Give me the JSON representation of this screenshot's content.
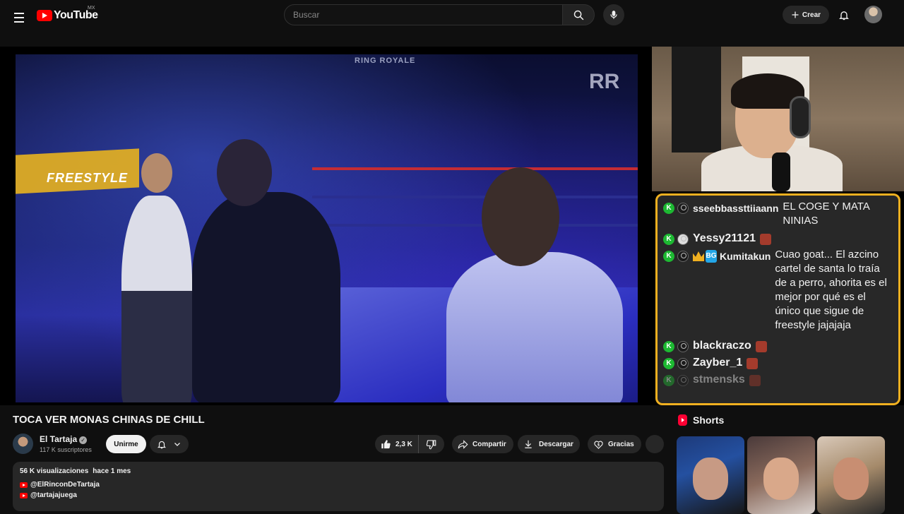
{
  "header": {
    "logo_text": "YouTube",
    "country_code": "MX",
    "search_placeholder": "Buscar",
    "create_label": "Crear"
  },
  "video": {
    "overlay_brand": "RING ROYALE",
    "banner_text": "FREESTYLE",
    "title": "TOCA VER MONAS CHINAS DE CHILL"
  },
  "channel": {
    "name": "El Tartaja",
    "subscribers": "117 K suscriptores",
    "join_label": "Unirme"
  },
  "actions": {
    "likes": "2,3 K",
    "share_label": "Compartir",
    "download_label": "Descargar",
    "thanks_label": "Gracias"
  },
  "description": {
    "views": "56 K visualizaciones",
    "date": "hace 1 mes",
    "links": [
      "@ElRinconDeTartaja",
      "@tartajajuega"
    ]
  },
  "chat": {
    "messages": [
      {
        "user": "sseebbassttiiaann",
        "text": "EL COGE Y MATA NINIAS"
      },
      {
        "user": "Yessy21121",
        "text": ""
      },
      {
        "user": "Kumitakun",
        "text": "Cuao goat... El azcino cartel de santa lo traía de a perro, ahorita es el mejor por qué es el único que sigue de freestyle jajajaja"
      },
      {
        "user": "blackraczo",
        "text": ""
      },
      {
        "user": "Zayber_1",
        "text": ""
      },
      {
        "user": "stmensks",
        "text": ""
      }
    ],
    "badge_letter": "K",
    "sub_badge": "BG",
    "accent": "#f0b020"
  },
  "sidebar": {
    "shorts_title": "Shorts"
  }
}
